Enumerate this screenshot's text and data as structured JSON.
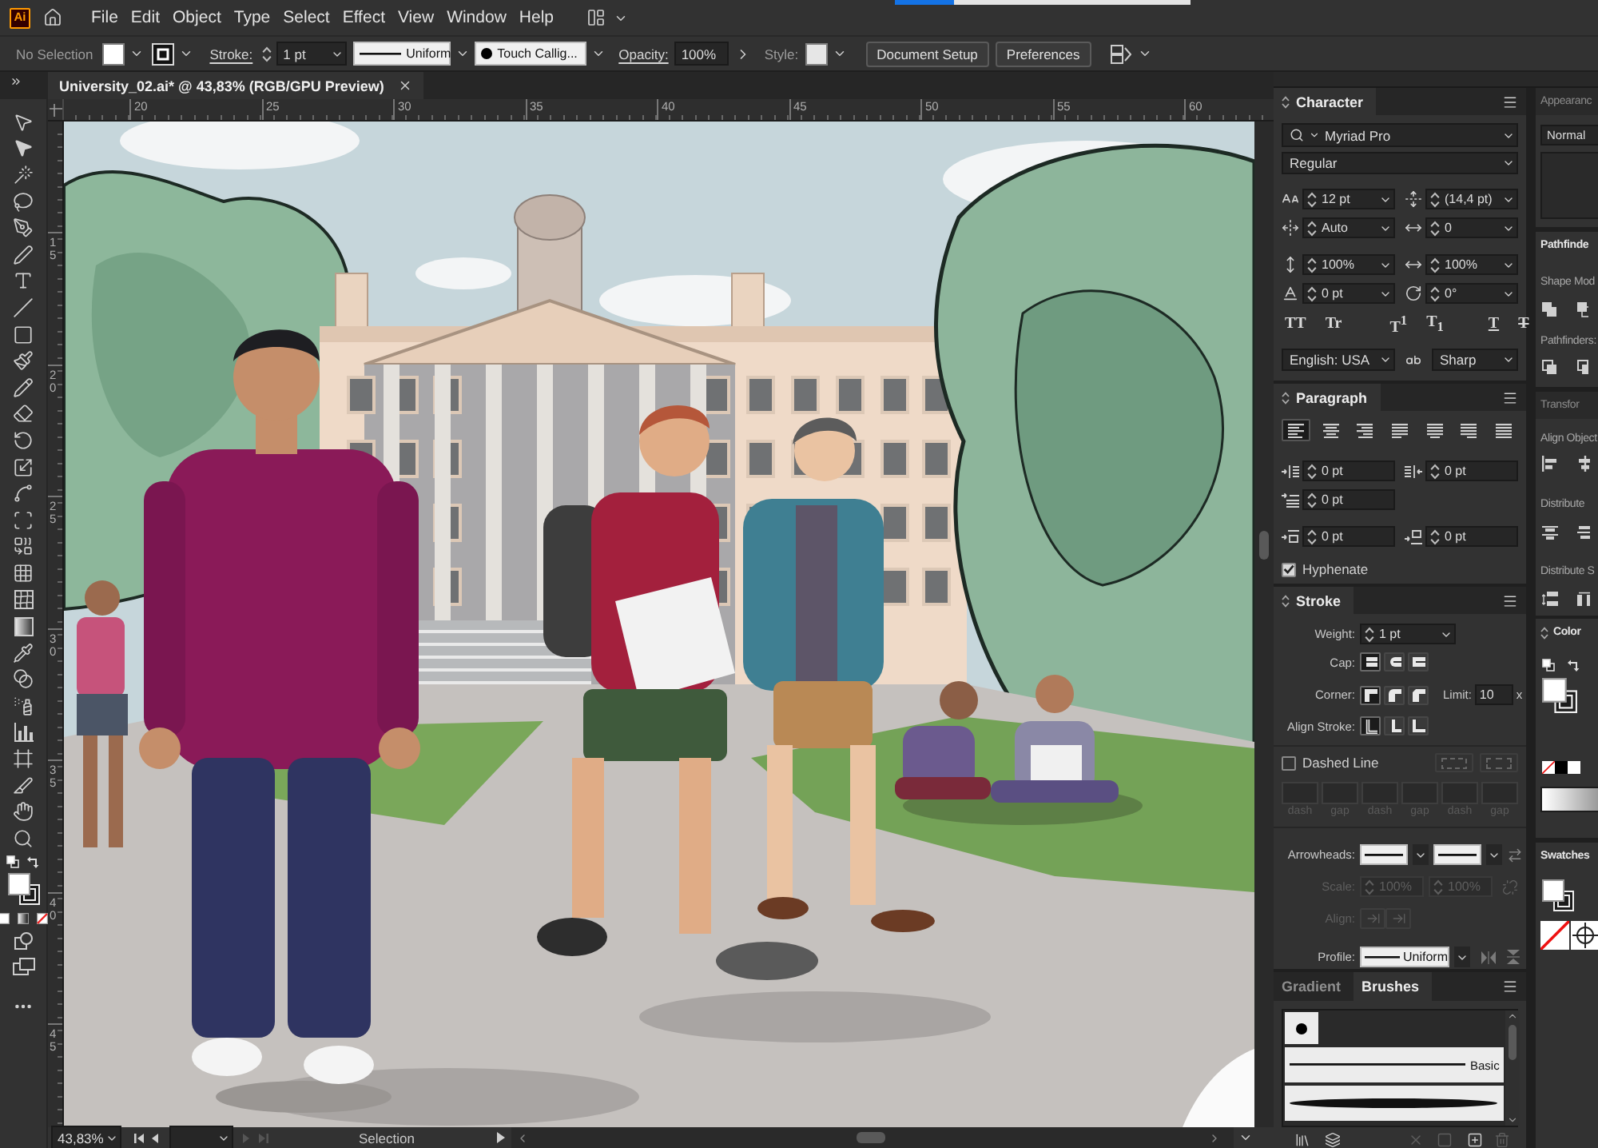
{
  "app": {
    "logo": "Ai"
  },
  "menu_bar": {
    "items": [
      "File",
      "Edit",
      "Object",
      "Type",
      "Select",
      "Effect",
      "View",
      "Window",
      "Help"
    ]
  },
  "control_bar": {
    "selection": "No Selection",
    "stroke_label": "Stroke:",
    "stroke_weight": "1 pt",
    "stroke_profile": "Uniform",
    "brush": "Touch Callig...",
    "opacity_label": "Opacity:",
    "opacity": "100%",
    "style_label": "Style:",
    "buttons": [
      "Document Setup",
      "Preferences"
    ]
  },
  "document_tab": {
    "title": "University_02.ai* @ 43,83% (RGB/GPU Preview)"
  },
  "rulers": {
    "horizontal": [
      "20",
      "25",
      "30",
      "35",
      "40",
      "45",
      "50",
      "55",
      "60"
    ],
    "vertical": [
      "15",
      "20",
      "25",
      "30",
      "35",
      "40",
      "45"
    ]
  },
  "status_bar": {
    "zoom": "43,83%",
    "navigation": [
      {
        "kind": "first",
        "disabled": false
      },
      {
        "kind": "previous",
        "disabled": false
      },
      {
        "kind": "next",
        "disabled": true
      },
      {
        "kind": "last",
        "disabled": true
      }
    ],
    "tool": "Selection"
  },
  "character_panel": {
    "title": "Character",
    "font_family": "Myriad Pro",
    "font_style": "Regular",
    "fields": [
      {
        "kind": "font_size",
        "value": "12 pt"
      },
      {
        "kind": "leading",
        "value": "(14,4 pt)"
      },
      {
        "kind": "kerning",
        "value": "Auto"
      },
      {
        "kind": "tracking",
        "value": "0"
      },
      {
        "kind": "vertical_scale",
        "value": "100%"
      },
      {
        "kind": "horizontal_scale",
        "value": "100%"
      },
      {
        "kind": "baseline_shift",
        "value": "0 pt"
      },
      {
        "kind": "rotation",
        "value": "0°"
      }
    ],
    "text_styles": [
      {
        "kind": "all_caps",
        "label": "TT"
      },
      {
        "kind": "small_caps",
        "label": "Tr"
      },
      {
        "kind": "superscript",
        "label": "T$^{1}$"
      },
      {
        "kind": "subscript",
        "label": "T$_{1}$"
      },
      {
        "kind": "underline",
        "label": "T"
      },
      {
        "kind": "strikethrough",
        "label": "T"
      }
    ],
    "language": "English: USA",
    "antialiasing": "Sharp"
  },
  "paragraph_panel": {
    "title": "Paragraph",
    "alignment": [
      {
        "kind": "left",
        "selected": true
      },
      {
        "kind": "center",
        "selected": false
      },
      {
        "kind": "right",
        "selected": false
      },
      {
        "kind": "justify_left",
        "selected": false
      },
      {
        "kind": "justify_center",
        "selected": false
      },
      {
        "kind": "justify_right",
        "selected": false
      },
      {
        "kind": "justify_all",
        "selected": false
      }
    ],
    "indents": [
      {
        "kind": "left_indent",
        "value": "0 pt"
      },
      {
        "kind": "right_indent",
        "value": "0 pt"
      },
      {
        "kind": "first_line_indent",
        "value": "0 pt"
      },
      {
        "kind": "space_before",
        "value": "0 pt"
      },
      {
        "kind": "space_after",
        "value": "0 pt"
      }
    ],
    "hyphenate": {
      "label": "Hyphenate",
      "checked": true
    }
  },
  "stroke_panel": {
    "title": "Stroke",
    "weight": {
      "label": "Weight:",
      "value": "1 pt"
    },
    "cap": {
      "label": "Cap:",
      "options": [
        {
          "kind": "butt",
          "selected": true
        },
        {
          "kind": "round",
          "selected": false
        },
        {
          "kind": "projecting",
          "selected": false
        }
      ]
    },
    "corner": {
      "label": "Corner:",
      "options": [
        {
          "kind": "miter",
          "selected": true
        },
        {
          "kind": "round",
          "selected": false
        },
        {
          "kind": "bevel",
          "selected": false
        }
      ],
      "limit_label": "Limit:",
      "limit": "10",
      "limit_unit": "x"
    },
    "align_stroke": {
      "label": "Align Stroke:",
      "options": [
        {
          "kind": "center",
          "selected": true
        },
        {
          "kind": "inside",
          "selected": false
        },
        {
          "kind": "outside",
          "selected": false
        }
      ]
    },
    "dashed_line": {
      "label": "Dashed Line",
      "checked": false,
      "pattern_labels": [
        "dash",
        "gap",
        "dash",
        "gap",
        "dash",
        "gap"
      ]
    },
    "arrowheads": {
      "label": "Arrowheads:"
    },
    "scale": {
      "label": "Scale:",
      "values": [
        "100%",
        "100%"
      ],
      "disabled": true
    },
    "arrow_align": {
      "label": "Align:",
      "disabled": true
    },
    "profile": {
      "label": "Profile:",
      "value": "Uniform"
    }
  },
  "brushes_panel": {
    "tabs": [
      {
        "label": "Gradient",
        "selected": false
      },
      {
        "label": "Brushes",
        "selected": true
      }
    ],
    "brushes": [
      {
        "kind": "dot"
      },
      {
        "kind": "line",
        "name": "Basic"
      },
      {
        "kind": "taper"
      }
    ],
    "actions": [
      {
        "kind": "libraries",
        "disabled": false
      },
      {
        "kind": "library_panel",
        "disabled": false
      },
      {
        "kind": "remove_stroke",
        "disabled": true
      },
      {
        "kind": "options",
        "disabled": true
      },
      {
        "kind": "new",
        "disabled": false
      },
      {
        "kind": "delete",
        "disabled": true
      }
    ]
  },
  "side_panels": {
    "appearance": {
      "tab": {
        "label": "Appearanc",
        "selected": false
      },
      "blend_mode": "Normal"
    },
    "pathfinder": {
      "tab": {
        "label": "Pathfinde",
        "selected": true
      },
      "shape_modes_label": "Shape Mod",
      "pathfinders_label": "Pathfinders:"
    },
    "transform": {
      "tab": {
        "label": "Transfor",
        "selected": false
      },
      "align_objects_label": "Align Object",
      "distribute_objects_label": "Distribute",
      "distribute_spacing_label": "Distribute S"
    },
    "color": {
      "tab": {
        "label": "Color",
        "selected": true
      }
    },
    "swatches": {
      "tab": {
        "label": "Swatches",
        "selected": true
      }
    }
  }
}
